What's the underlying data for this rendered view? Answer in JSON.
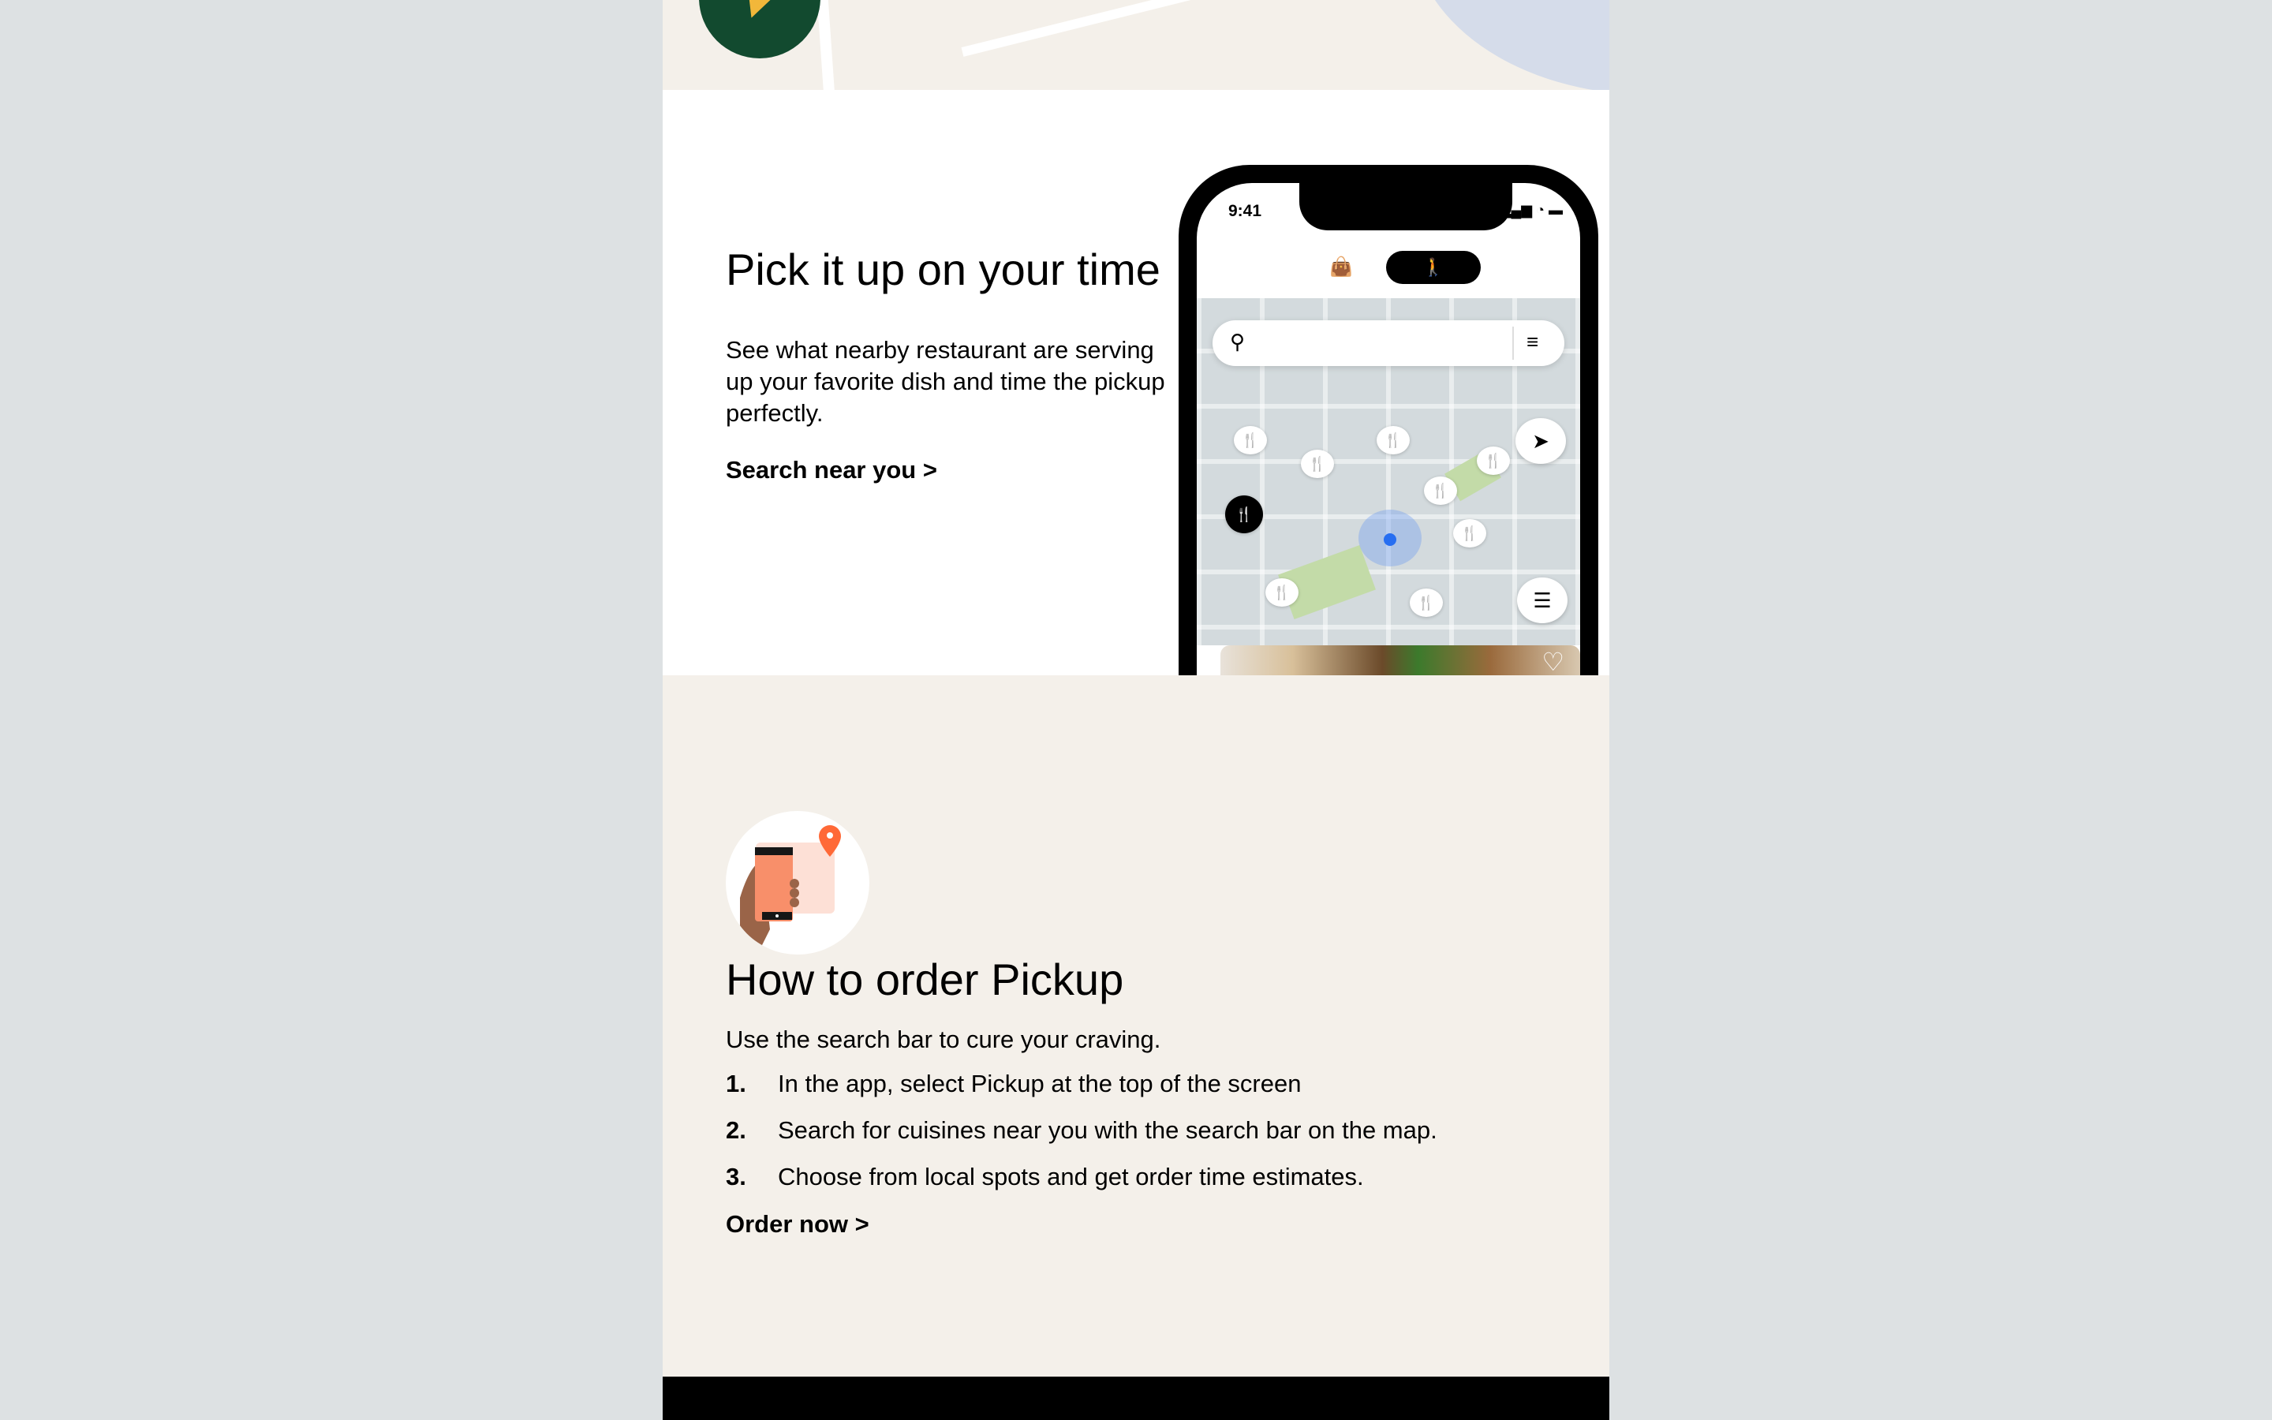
{
  "pickup_section": {
    "title": "Pick it up on your time",
    "description": "See what nearby restaurant are serving up your favorite dish and time the pickup perfectly.",
    "link": "Search near you >"
  },
  "phone": {
    "time": "9:41",
    "status_icons": "▂▄▆ ◔ ▬",
    "delivery_icon": "👜",
    "pickup_icon": "🚶",
    "search_icon": "⚲",
    "filter_icon": "≡",
    "restaurant_pin": "🍴",
    "locate_icon": "➤",
    "list_icon": "☰",
    "heart_icon": "♡"
  },
  "how_to": {
    "title": "How to order Pickup",
    "intro": "Use the search bar to cure your craving.",
    "steps": [
      {
        "num": "1.",
        "text": "In the app, select Pickup at the top of the screen"
      },
      {
        "num": "2.",
        "text": "Search for cuisines near you with the search bar on the map."
      },
      {
        "num": "3.",
        "text": "Choose from local spots and get order time estimates."
      }
    ],
    "link": "Order now >"
  }
}
